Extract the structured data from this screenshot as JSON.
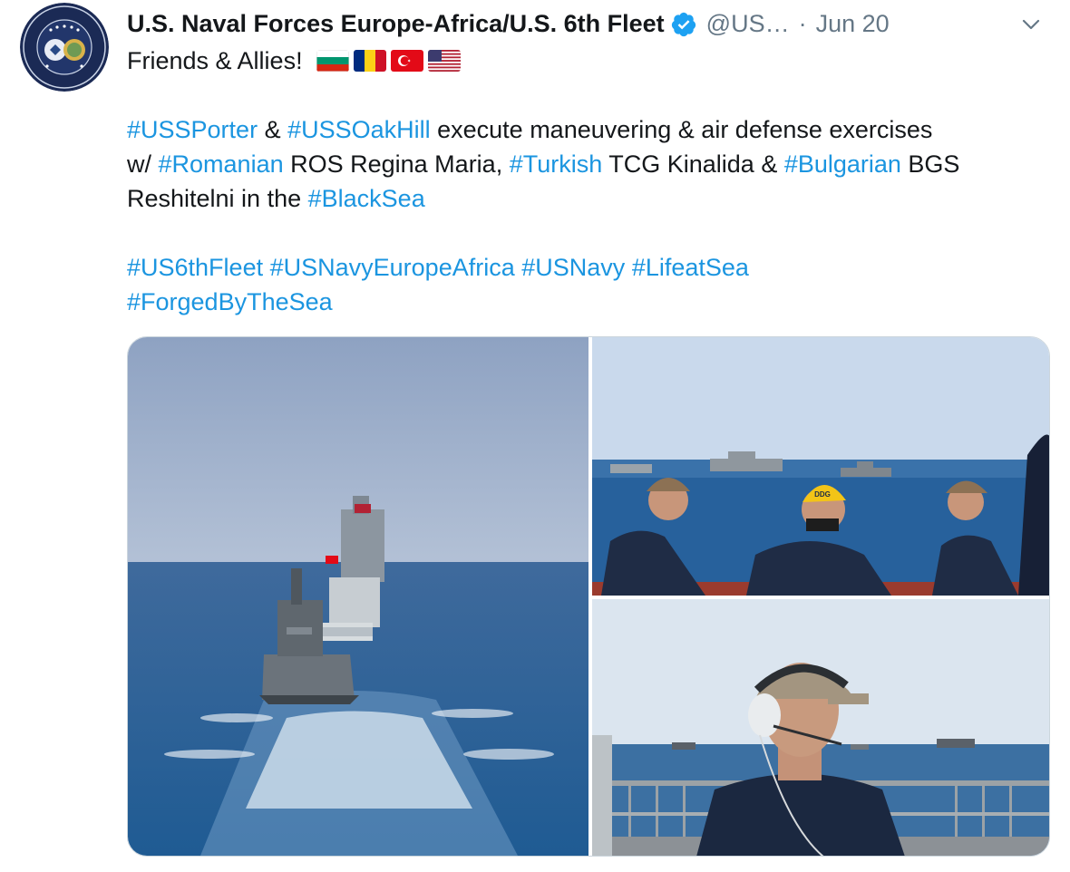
{
  "tweet": {
    "display_name": "U.S. Naval Forces Europe-Africa/U.S. 6th Fleet",
    "handle": "@US…",
    "separator": "·",
    "date": "Jun 20",
    "verified": true,
    "avatar_icon": "naval-forces-europe-africa-seal",
    "caret_icon": "chevron-down-icon",
    "text": {
      "line1": "Friends & Allies!",
      "flags": [
        "flag-bulgaria",
        "flag-romania",
        "flag-turkey",
        "flag-united-states"
      ],
      "p2_l1_tag1": "#USSPorter",
      "p2_l1_amp": " & ",
      "p2_l1_tag2": "#USSOakHill",
      "p2_l1_rest": " execute maneuvering & air defense exercises",
      "p2_l2_pre": "w/ ",
      "p2_l2_tag1": "#Romanian",
      "p2_l2_mid1": " ROS Regina Maria, ",
      "p2_l2_tag2": "#Turkish",
      "p2_l2_mid2": " TCG Kinalida & ",
      "p2_l2_tag3": "#Bulgarian",
      "p2_l2_rest": " BGS",
      "p2_l3_pre": "Reshitelni in the ",
      "p2_l3_tag": "#BlackSea",
      "hashtags_line1": [
        "#US6thFleet",
        "#USNavyEuropeAfrica",
        "#USNavy",
        "#LifeatSea"
      ],
      "hashtags_line2": [
        "#ForgedByTheSea"
      ]
    },
    "media": {
      "photos": [
        {
          "name": "ships-in-column-photo"
        },
        {
          "name": "sailors-watching-ships-photo",
          "cap_text": "DDG"
        },
        {
          "name": "sailor-with-headset-photo"
        }
      ]
    }
  },
  "colors": {
    "text": "#14171a",
    "muted": "#657786",
    "link": "#1b95e0",
    "verified": "#1da1f2",
    "border": "#ccd6dd"
  }
}
